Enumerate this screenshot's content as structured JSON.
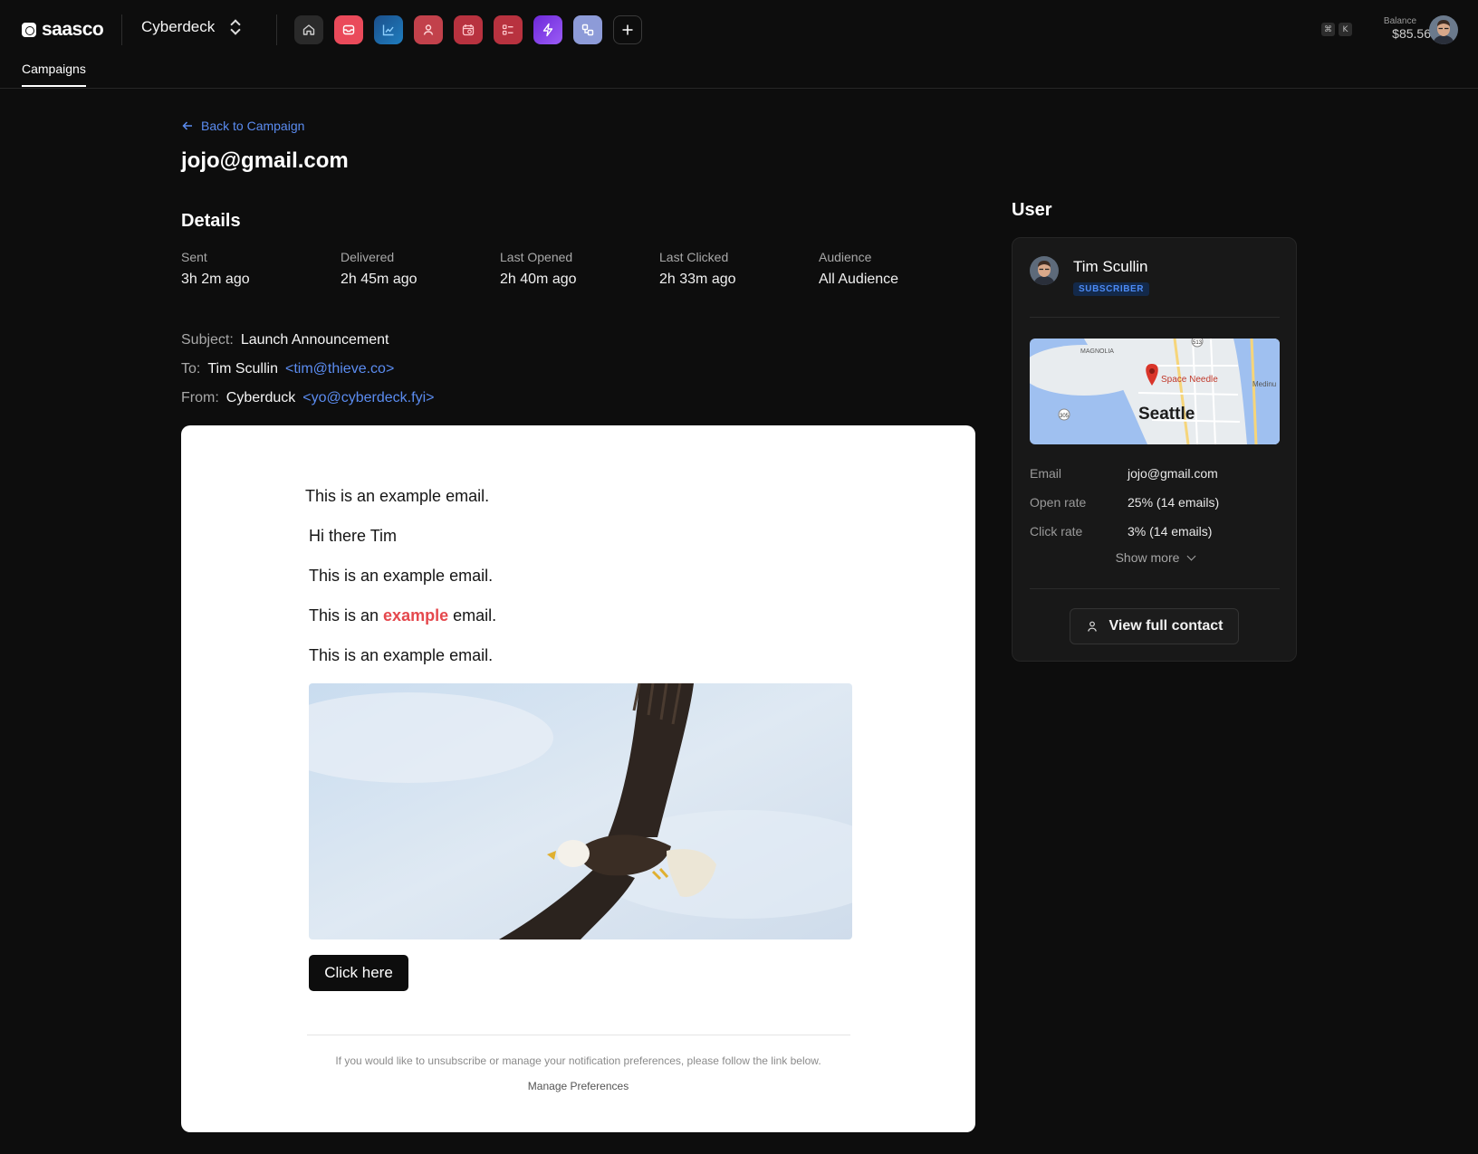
{
  "brand": {
    "name": "saasco"
  },
  "workspace": {
    "name": "Cyberdeck"
  },
  "apps": [
    {
      "icon": "home-icon",
      "color": "#2a2a2a"
    },
    {
      "icon": "mail-icon",
      "color": "#ea4a5a"
    },
    {
      "icon": "chart-icon",
      "color": "#1a6fb0"
    },
    {
      "icon": "user-icon",
      "color": "#c2414b"
    },
    {
      "icon": "calendar-icon",
      "color": "#b8323f"
    },
    {
      "icon": "checklist-icon",
      "color": "#b8323f"
    },
    {
      "icon": "bolt-icon",
      "color": "#7c3aed"
    },
    {
      "icon": "shapes-icon",
      "color": "#8d9bd8"
    }
  ],
  "shortcut": {
    "key1": "⌘",
    "key2": "K"
  },
  "balance": {
    "label": "Balance",
    "value": "$85.56"
  },
  "tabs": {
    "active": "Campaigns"
  },
  "back": {
    "label": "Back to Campaign"
  },
  "page": {
    "title": "jojo@gmail.com"
  },
  "details": {
    "title": "Details",
    "stats": [
      {
        "label": "Sent",
        "value": "3h 2m ago"
      },
      {
        "label": "Delivered",
        "value": "2h 45m ago"
      },
      {
        "label": "Last Opened",
        "value": "2h 40m ago"
      },
      {
        "label": "Last Clicked",
        "value": "2h 33m ago"
      },
      {
        "label": "Audience",
        "value": "All Audience"
      }
    ],
    "subject": {
      "key": "Subject:",
      "value": "Launch Announcement"
    },
    "to": {
      "key": "To:",
      "name": "Tim Scullin",
      "email": "<tim@thieve.co>"
    },
    "from": {
      "key": "From:",
      "name": "Cyberduck",
      "email": "<yo@cyberdeck.fyi>"
    }
  },
  "email": {
    "line1": "This is an example email.",
    "greeting": "Hi there Tim",
    "line2": "This is an example email.",
    "line3_pre": "This is an",
    "line3_highlight": "example",
    "line3_post": "email.",
    "line4": "This is an example email.",
    "cta": "Click here",
    "footer_text": "If you would like to unsubscribe or manage your notification preferences, please follow the link below.",
    "footer_link": "Manage Preferences"
  },
  "user": {
    "title": "User",
    "name": "Tim Scullin",
    "badge": "SUBSCRIBER",
    "map": {
      "city": "Seattle",
      "poi": "Space Needle",
      "area1": "MAGNOLIA",
      "area2": "Medinu",
      "route1": "305",
      "route2": "513"
    },
    "rows": [
      {
        "key": "Email",
        "value": "jojo@gmail.com"
      },
      {
        "key": "Open rate",
        "value": "25% (14 emails)"
      },
      {
        "key": "Click rate",
        "value": "3% (14 emails)"
      }
    ],
    "show_more": "Show more",
    "view_contact": "View full contact"
  }
}
